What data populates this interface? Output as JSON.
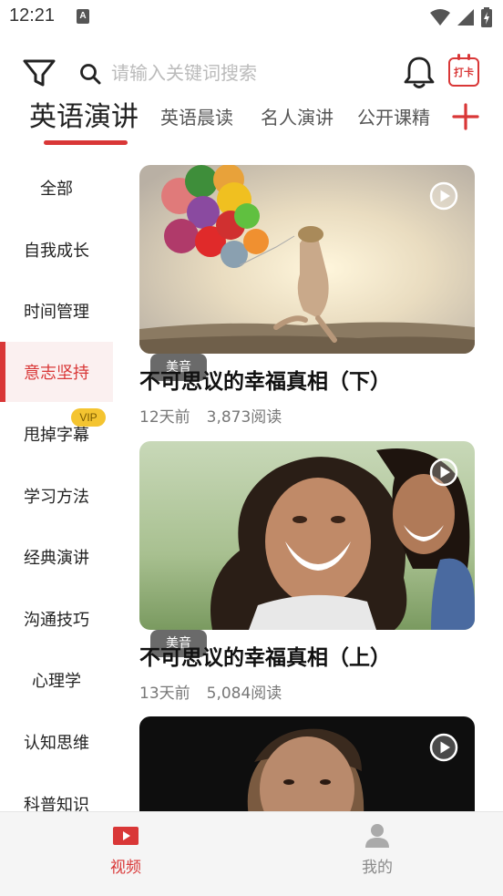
{
  "status_bar": {
    "time": "12:21",
    "notif_letter": "A"
  },
  "search": {
    "placeholder": "请输入关键词搜索",
    "value": ""
  },
  "checkin": {
    "label": "打卡"
  },
  "tabs": [
    {
      "label": "英语演讲",
      "active": true
    },
    {
      "label": "英语晨读",
      "active": false
    },
    {
      "label": "名人演讲",
      "active": false
    },
    {
      "label": "公开课精",
      "active": false
    }
  ],
  "sidebar": {
    "items": [
      {
        "label": "全部",
        "active": false
      },
      {
        "label": "自我成长",
        "active": false
      },
      {
        "label": "时间管理",
        "active": false
      },
      {
        "label": "意志坚持",
        "active": true
      },
      {
        "label": "甩掉字幕",
        "active": false
      },
      {
        "label": "学习方法",
        "active": false
      },
      {
        "label": "经典演讲",
        "active": false
      },
      {
        "label": "沟通技巧",
        "active": false
      },
      {
        "label": "心理学",
        "active": false
      },
      {
        "label": "认知思维",
        "active": false
      },
      {
        "label": "科普知识",
        "active": false
      }
    ],
    "vip_badge": "VIP"
  },
  "feed": {
    "cards": [
      {
        "title": "不可思议的幸福真相（下）",
        "tag": "美音",
        "age": "12天前",
        "reads": "3,873阅读"
      },
      {
        "title": "不可思议的幸福真相（上）",
        "tag": "美音",
        "age": "13天前",
        "reads": "5,084阅读"
      },
      {
        "title": "",
        "tag": "",
        "age": "",
        "reads": ""
      }
    ]
  },
  "bottom_nav": {
    "video_label": "视频",
    "mine_label": "我的"
  },
  "colors": {
    "accent": "#d93737",
    "vip": "#f4c430"
  }
}
